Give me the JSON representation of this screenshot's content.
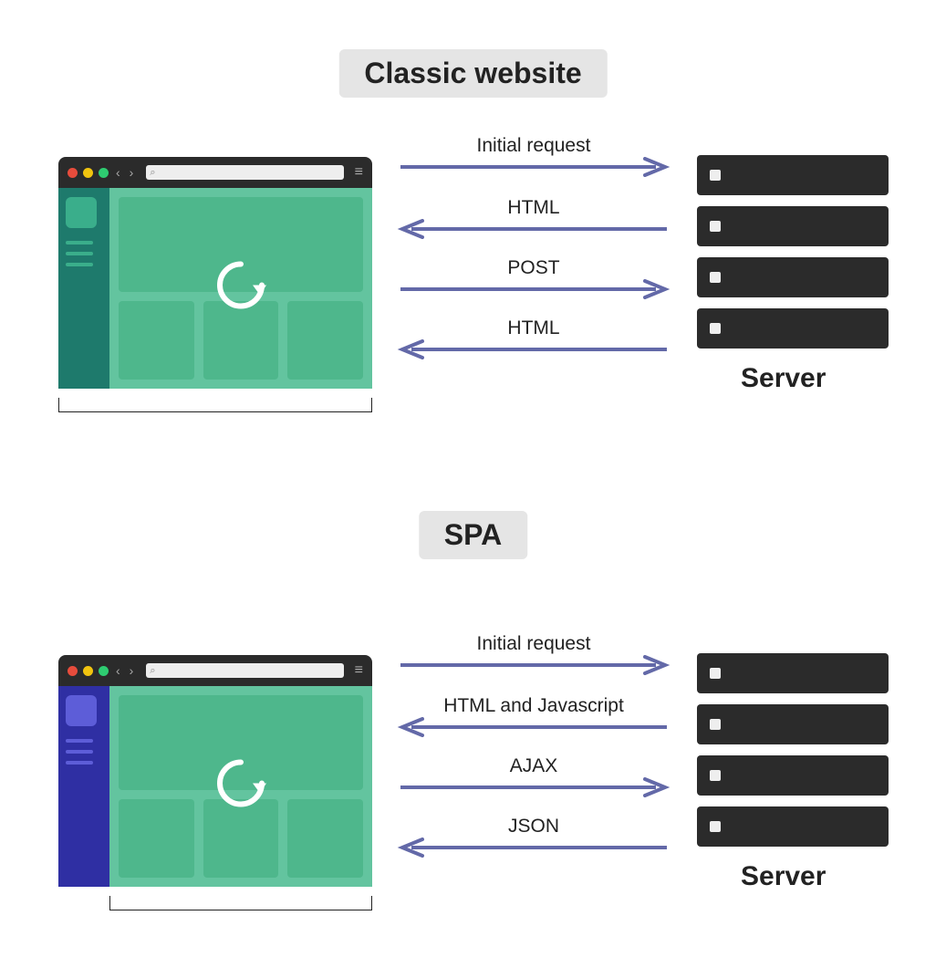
{
  "titles": {
    "classic": "Classic website",
    "spa": "SPA"
  },
  "arrows": {
    "classic": [
      {
        "label": "Initial request",
        "dir": "right"
      },
      {
        "label": "HTML",
        "dir": "left"
      },
      {
        "label": "POST",
        "dir": "right"
      },
      {
        "label": "HTML",
        "dir": "left"
      }
    ],
    "spa": [
      {
        "label": "Initial request",
        "dir": "right"
      },
      {
        "label": "HTML and Javascript",
        "dir": "left"
      },
      {
        "label": "AJAX",
        "dir": "right"
      },
      {
        "label": "JSON",
        "dir": "left"
      }
    ]
  },
  "server_label": "Server",
  "colors": {
    "arrow": "#6369a8",
    "classic_sidebar": "#1e7a6c",
    "spa_sidebar": "#2f2fa3",
    "content_bg": "#63c49f",
    "panel": "#4eb78c",
    "rack": "#2b2b2b"
  },
  "icon_names": {
    "traffic_red": "traffic-light-red-icon",
    "traffic_yellow": "traffic-light-yellow-icon",
    "traffic_green": "traffic-light-green-icon",
    "reload": "reload-icon",
    "search": "search-icon",
    "menu": "menu-icon"
  }
}
